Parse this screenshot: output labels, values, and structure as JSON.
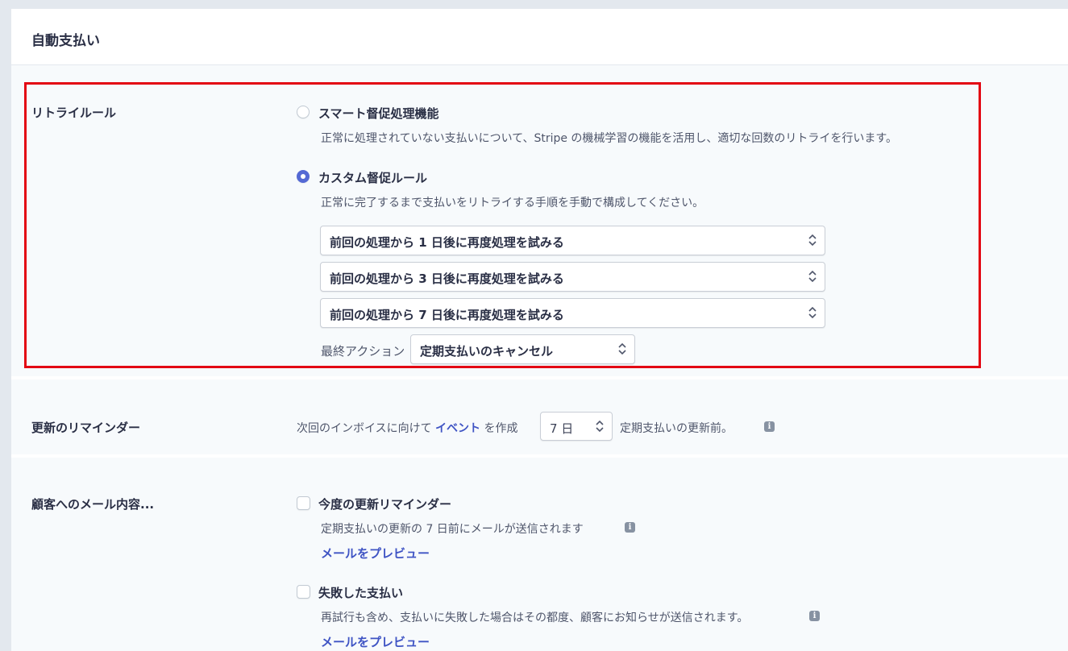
{
  "page": {
    "title": "自動支払い"
  },
  "retry": {
    "label": "リトライルール",
    "smart": {
      "title": "スマート督促処理機能",
      "description": "正常に処理されていない支払いについて、Stripe の機械学習の機能を活用し、適切な回数のリトライを行います。",
      "selected": false
    },
    "custom": {
      "title": "カスタム督促ルール",
      "description": "正常に完了するまで支払いをリトライする手順を手動で構成してください。",
      "selected": true
    },
    "steps": [
      "前回の処理から 1 日後に再度処理を試みる",
      "前回の処理から 3 日後に再度処理を試みる",
      "前回の処理から 7 日後に再度処理を試みる"
    ],
    "final_action_label": "最終アクション",
    "final_action_value": "定期支払いのキャンセル"
  },
  "reminder": {
    "label": "更新のリマインダー",
    "prefix": "次回のインボイスに向けて",
    "event_link": "イベント",
    "middle": "を作成",
    "days_value": "7 日",
    "suffix": "定期支払いの更新前。"
  },
  "email": {
    "label": "顧客へのメール内容...",
    "items": [
      {
        "title": "今度の更新リマインダー",
        "description": "定期支払いの更新の 7 日前にメールが送信されます",
        "preview_link": "メールをプレビュー",
        "checked": false
      },
      {
        "title": "失敗した支払い",
        "description": "再試行も含め、支払いに失敗した場合はその都度、顧客にお知らせが送信されます。",
        "preview_link": "メールをプレビュー",
        "checked": false
      }
    ]
  },
  "icons": {
    "info": "i"
  },
  "colors": {
    "accent": "#5469d4",
    "link": "#3f54c4",
    "highlight": "#e30613",
    "section_bg": "#f7fafc"
  }
}
